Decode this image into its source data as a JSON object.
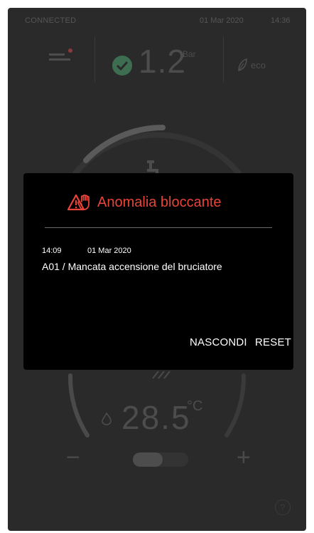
{
  "status_bar": {
    "connection": "CONNECTED",
    "date": "01 Mar 2020",
    "time": "14:36"
  },
  "top_bar": {
    "pressure_value": "1.2",
    "pressure_unit": "Bar",
    "eco_label": "eco",
    "menu_icon": "menu-icon",
    "pressure_status_icon": "check-circle-icon",
    "eco_icon": "leaf-icon"
  },
  "main": {
    "temperature_value": "28.5",
    "temperature_unit": "°C",
    "minus_label": "−",
    "plus_label": "+",
    "help_label": "?",
    "tap_icon": "tap-icon",
    "flame_icon": "flame-icon"
  },
  "dialog": {
    "title": "Anomalia bloccante",
    "time": "14:09",
    "date": "01 Mar 2020",
    "message": "A01 / Mancata accensione del bruciatore",
    "hide_label": "NASCONDI",
    "reset_label": "RESET",
    "title_color": "#e8443a"
  },
  "colors": {
    "background": "#2a2a2a",
    "dialog_background": "#000000",
    "accent_green": "#3e6e51",
    "alert_red": "#e8443a"
  }
}
